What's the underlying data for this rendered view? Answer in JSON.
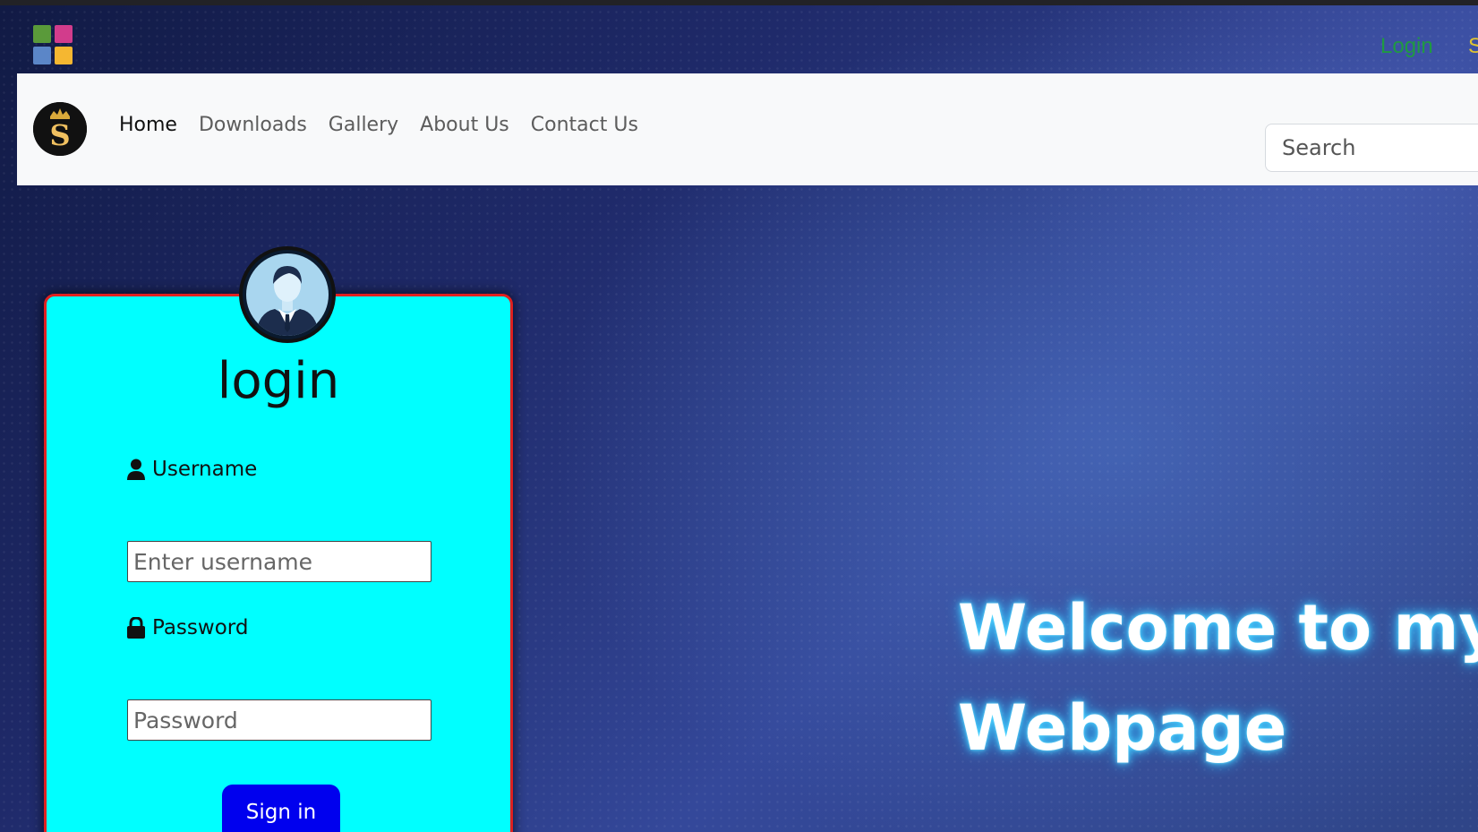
{
  "header": {
    "login_link": "Login",
    "signup_link": "S"
  },
  "nav": {
    "links": [
      "Home",
      "Downloads",
      "Gallery",
      "About Us",
      "Contact Us"
    ],
    "active_index": 0,
    "search_placeholder": "Search",
    "brand_letter": "S"
  },
  "login_card": {
    "title": "login",
    "username_label": "Username",
    "username_placeholder": "Enter username",
    "password_label": "Password",
    "password_placeholder": "Password",
    "signin_label": "Sign in",
    "icons": {
      "user": "user-icon",
      "lock": "lock-icon",
      "avatar": "businessman-avatar-icon"
    }
  },
  "hero": {
    "line1": "Welcome to my",
    "line2": "Webpage"
  },
  "colors": {
    "card_bg": "#00ffff",
    "card_border": "#e02020",
    "signin_bg": "#0000ee",
    "login_link": "#1f9a42",
    "signup_link": "#e0c430",
    "welcome_glow": "#4fd8ff"
  }
}
